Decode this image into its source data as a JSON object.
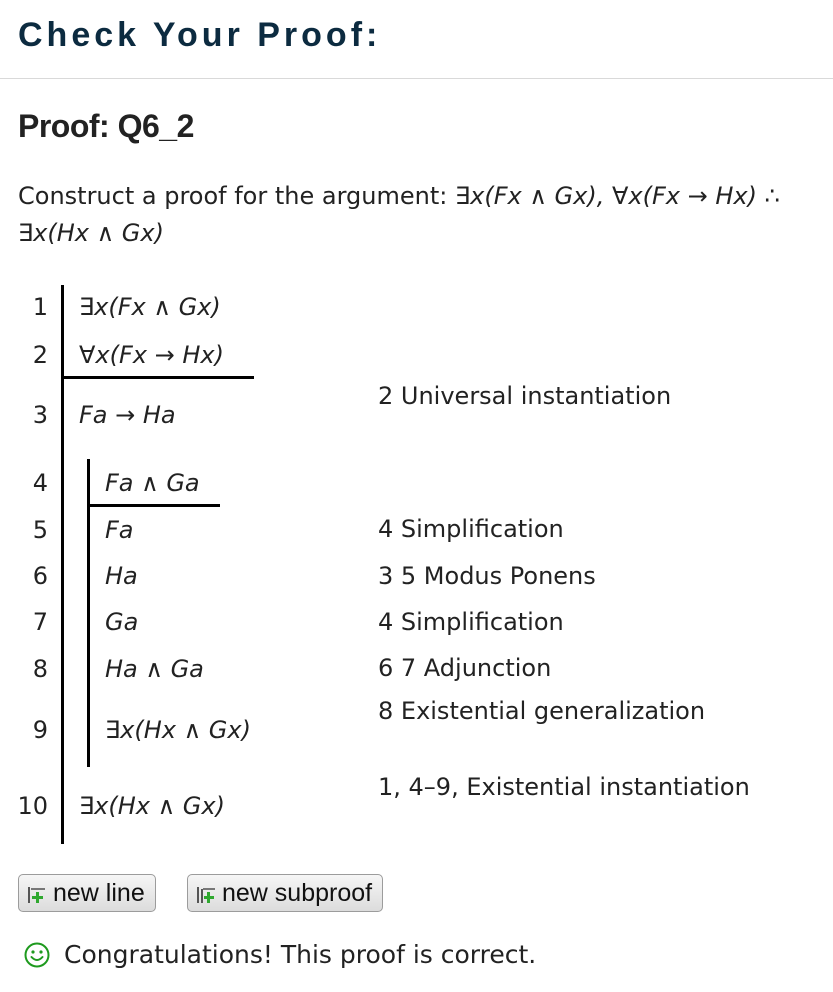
{
  "header": {
    "title": "Check Your Proof:"
  },
  "proof": {
    "title": "Proof: Q6_2",
    "question_prefix": "Construct a proof for the argument:",
    "question_formula": "∃x(Fx ∧ Gx), ∀x(Fx → Hx) ∴ ∃x(Hx ∧ Gx)",
    "lines": [
      {
        "num": "1",
        "formula": "∃x(Fx ∧ Gx)",
        "justification": ""
      },
      {
        "num": "2",
        "formula": "∀x(Fx → Hx)",
        "justification": ""
      },
      {
        "num": "3",
        "formula": "Fa → Ha",
        "justification": "2 Universal instantiation"
      },
      {
        "num": "4",
        "formula": "Fa ∧ Ga",
        "justification": ""
      },
      {
        "num": "5",
        "formula": "Fa",
        "justification": "4 Simplification"
      },
      {
        "num": "6",
        "formula": "Ha",
        "justification": "3 5 Modus Ponens"
      },
      {
        "num": "7",
        "formula": "Ga",
        "justification": "4 Simplification"
      },
      {
        "num": "8",
        "formula": "Ha ∧ Ga",
        "justification": "6 7 Adjunction"
      },
      {
        "num": "9",
        "formula": "∃x(Hx ∧ Gx)",
        "justification": "8 Existential generalization"
      },
      {
        "num": "10",
        "formula": "∃x(Hx ∧ Gx)",
        "justification": "1, 4–9, Existential instantiation"
      }
    ]
  },
  "buttons": {
    "new_line": "new line",
    "new_subproof": "new subproof"
  },
  "status": {
    "message": "Congratulations! This proof is correct.",
    "icon": "smiley-icon",
    "color": "#1e9a1e"
  }
}
